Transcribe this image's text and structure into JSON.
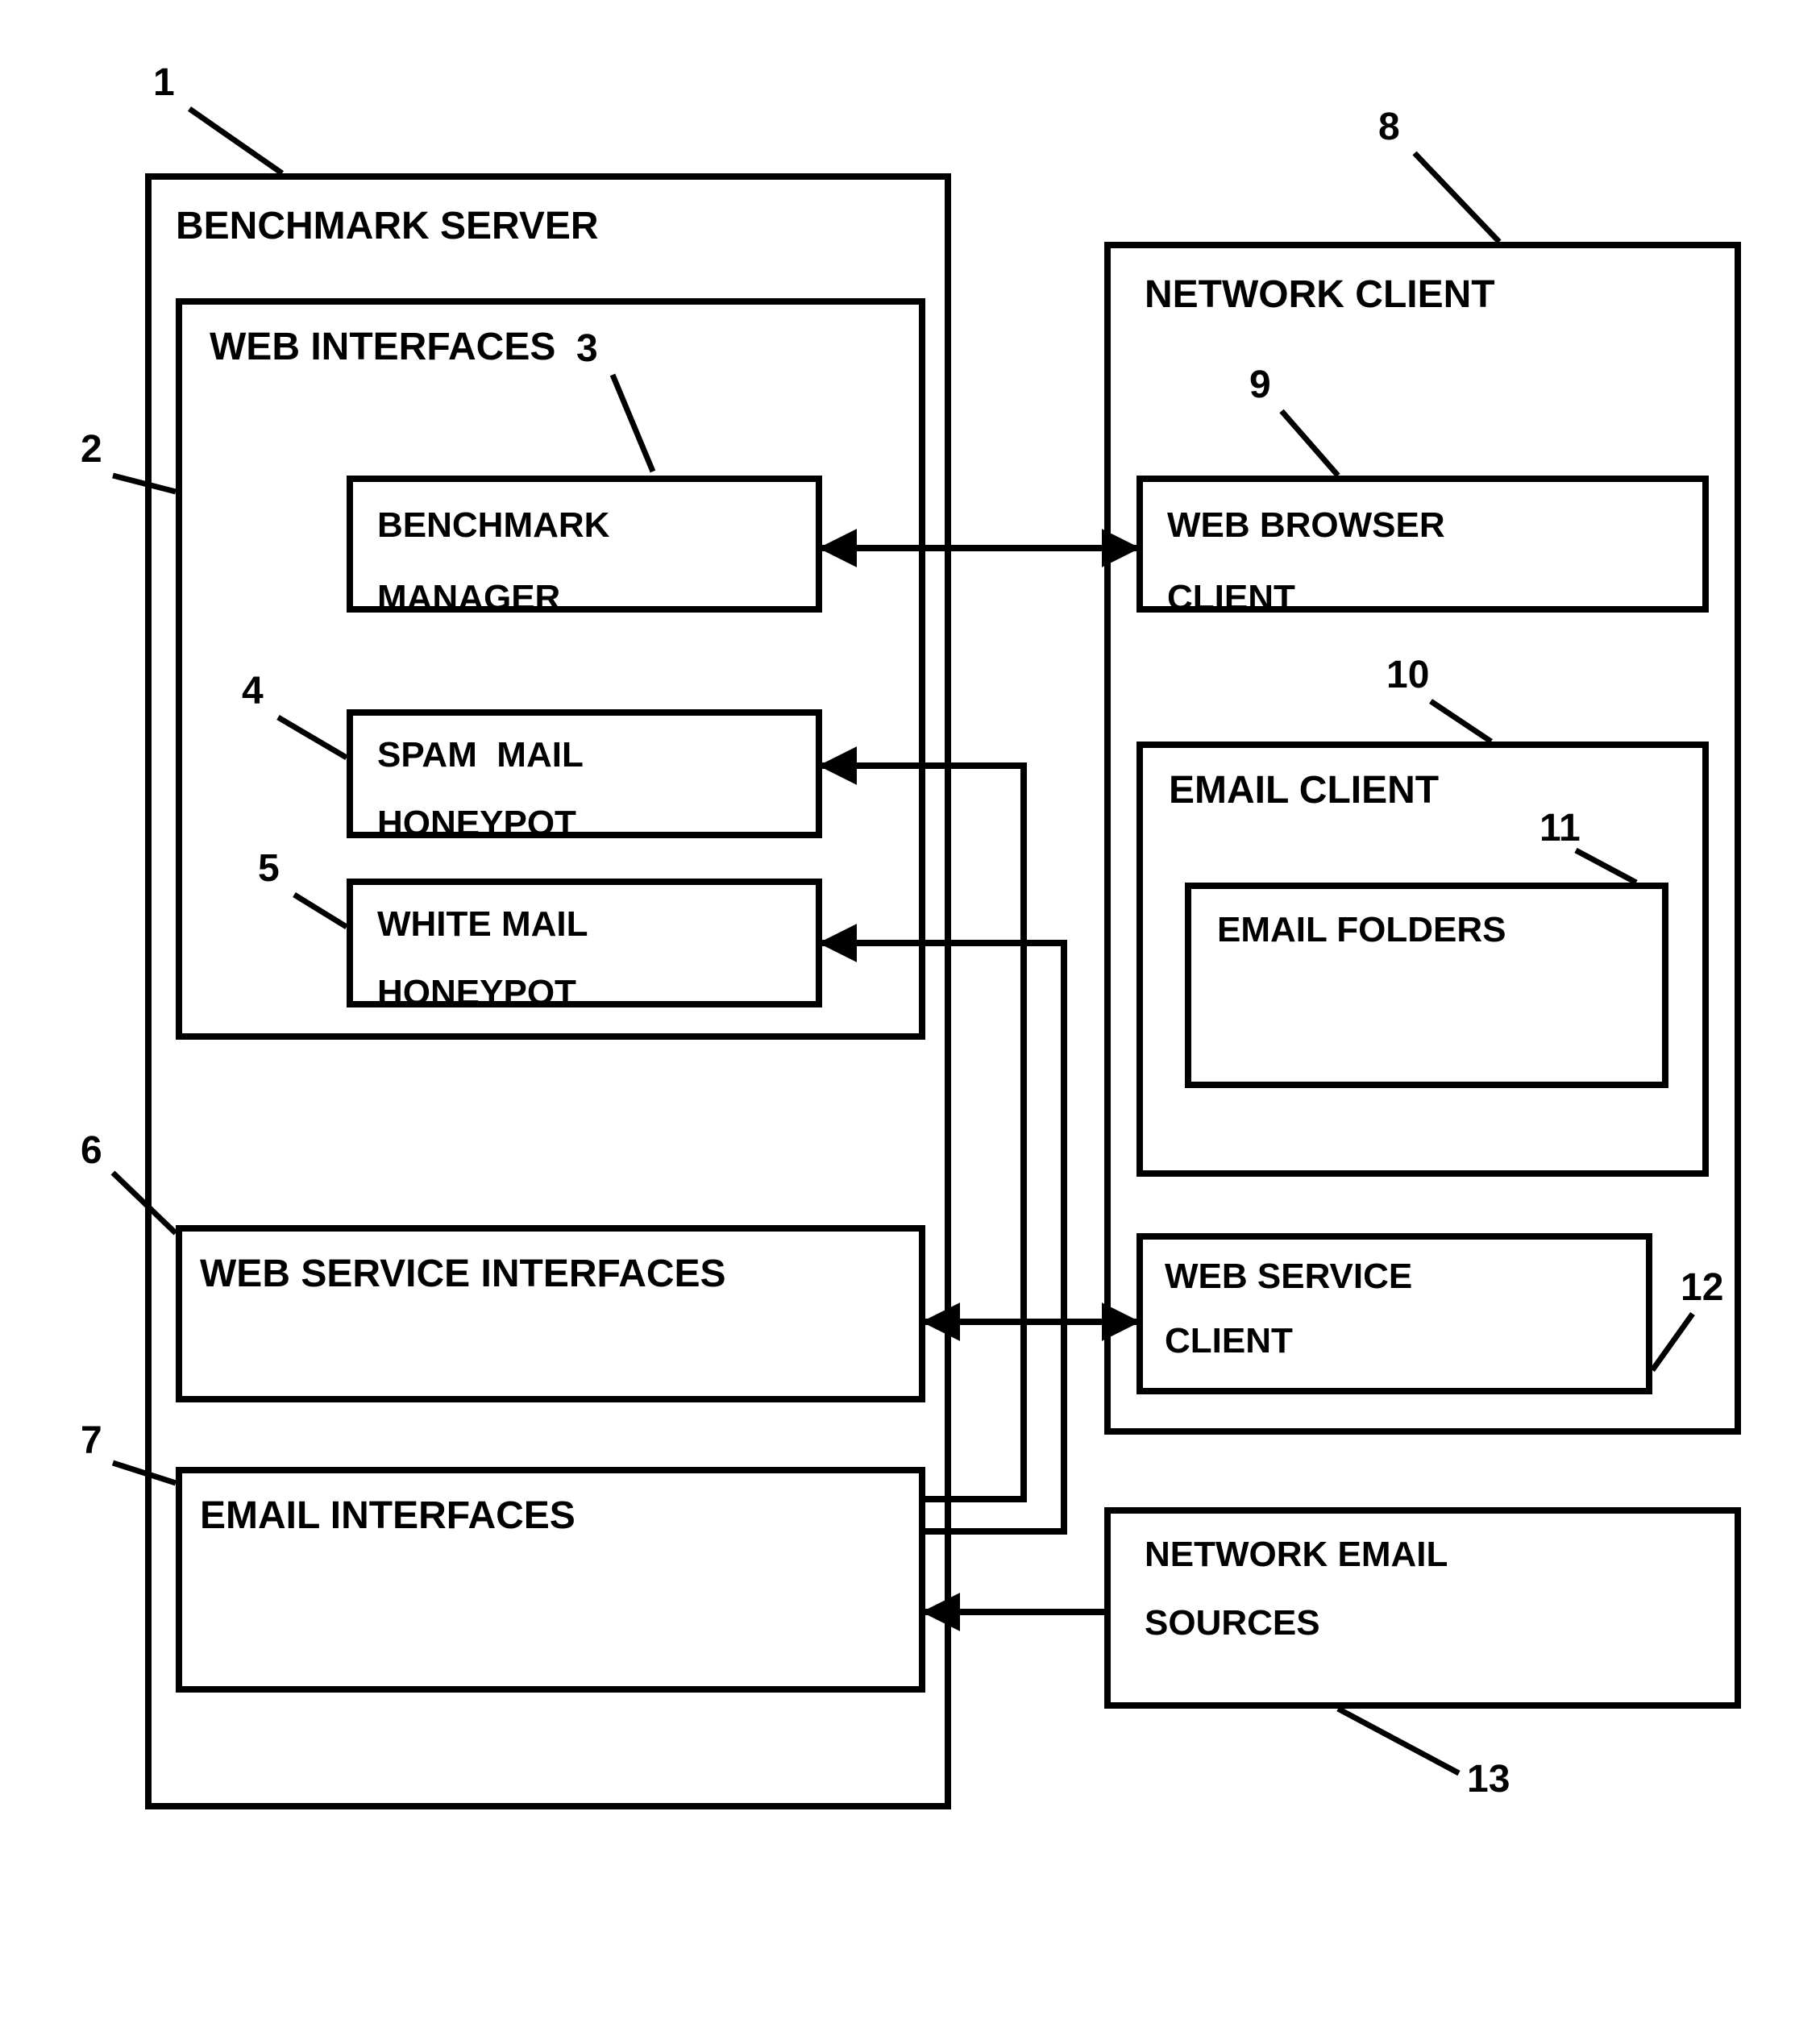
{
  "refs": {
    "n1": "1",
    "n2": "2",
    "n3": "3",
    "n4": "4",
    "n5": "5",
    "n6": "6",
    "n7": "7",
    "n8": "8",
    "n9": "9",
    "n10": "10",
    "n11": "11",
    "n12": "12",
    "n13": "13"
  },
  "server": {
    "title": "BENCHMARK SERVER",
    "web_interfaces": {
      "title": "WEB INTERFACES",
      "benchmark_manager_l1": "BENCHMARK",
      "benchmark_manager_l2": "MANAGER",
      "spam_honeypot_l1": "SPAM  MAIL",
      "spam_honeypot_l2": "HONEYPOT",
      "white_honeypot_l1": "WHITE MAIL",
      "white_honeypot_l2": "HONEYPOT"
    },
    "web_service_interfaces": "WEB SERVICE INTERFACES",
    "email_interfaces": "EMAIL INTERFACES"
  },
  "client": {
    "title": "NETWORK CLIENT",
    "web_browser_l1": "WEB BROWSER",
    "web_browser_l2": "CLIENT",
    "email_client_title": "EMAIL CLIENT",
    "email_folders": "EMAIL FOLDERS",
    "web_service_client_l1": "WEB SERVICE",
    "web_service_client_l2": "CLIENT"
  },
  "network_email_sources_l1": "NETWORK EMAIL",
  "network_email_sources_l2": "SOURCES"
}
